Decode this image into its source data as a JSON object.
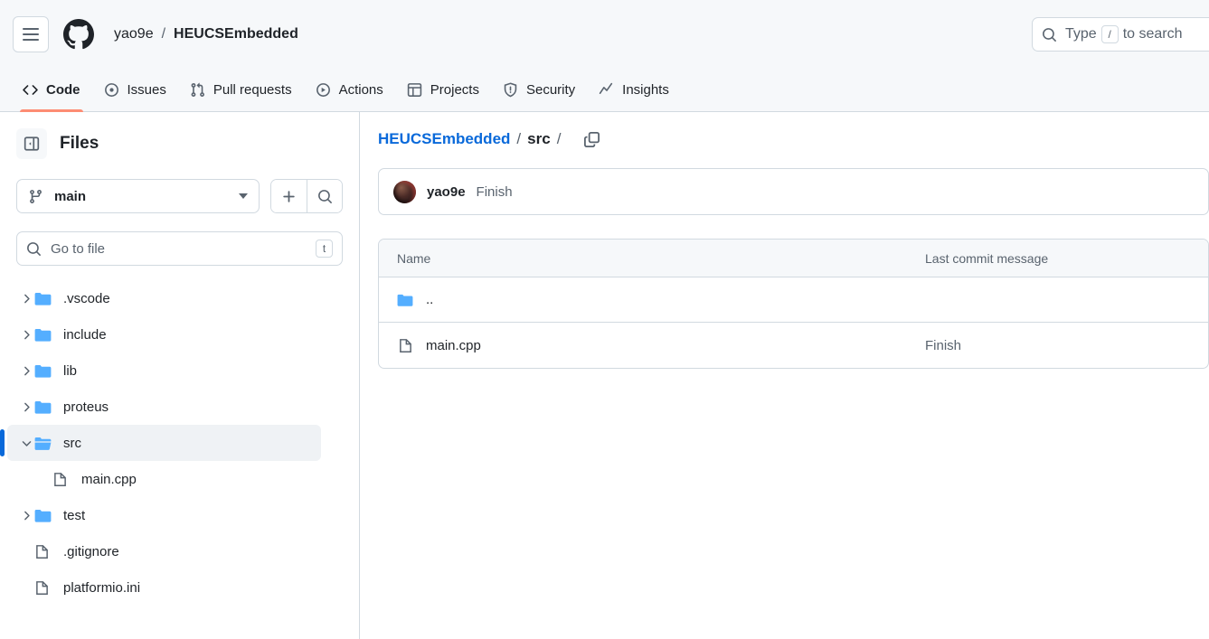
{
  "header": {
    "menu_label": "Open global navigation menu",
    "logo_name": "github-logo",
    "owner": "yao9e",
    "separator": "/",
    "repo": "HEUCSEmbedded",
    "search": {
      "placeholder_before": "Type",
      "key_hint": "/",
      "placeholder_after": "to search"
    }
  },
  "nav": {
    "tabs": [
      {
        "label": "Code",
        "icon": "code-icon",
        "active": true
      },
      {
        "label": "Issues",
        "icon": "issue-opened-icon",
        "active": false
      },
      {
        "label": "Pull requests",
        "icon": "git-pull-request-icon",
        "active": false
      },
      {
        "label": "Actions",
        "icon": "play-icon",
        "active": false
      },
      {
        "label": "Projects",
        "icon": "table-icon",
        "active": false
      },
      {
        "label": "Security",
        "icon": "shield-icon",
        "active": false
      },
      {
        "label": "Insights",
        "icon": "graph-icon",
        "active": false
      }
    ]
  },
  "sidebar": {
    "panel_icon": "sidebar-collapse-icon",
    "title": "Files",
    "branch": {
      "icon": "git-branch-icon",
      "name": "main",
      "chevron": "chevron-down-icon"
    },
    "add_button": "add-file-icon",
    "search_button": "search-icon",
    "file_search": {
      "icon": "search-icon",
      "placeholder": "Go to file",
      "shortcut": "t"
    },
    "tree": [
      {
        "label": ".vscode",
        "type": "folder",
        "expanded": false,
        "selected": false,
        "indent": false
      },
      {
        "label": "include",
        "type": "folder",
        "expanded": false,
        "selected": false,
        "indent": false
      },
      {
        "label": "lib",
        "type": "folder",
        "expanded": false,
        "selected": false,
        "indent": false
      },
      {
        "label": "proteus",
        "type": "folder",
        "expanded": false,
        "selected": false,
        "indent": false
      },
      {
        "label": "src",
        "type": "folder-open",
        "expanded": true,
        "selected": true,
        "indent": false
      },
      {
        "label": "main.cpp",
        "type": "file",
        "expanded": false,
        "selected": false,
        "indent": true
      },
      {
        "label": "test",
        "type": "folder",
        "expanded": false,
        "selected": false,
        "indent": false
      },
      {
        "label": ".gitignore",
        "type": "file",
        "expanded": false,
        "selected": false,
        "indent": false
      },
      {
        "label": "platformio.ini",
        "type": "file",
        "expanded": false,
        "selected": false,
        "indent": false
      }
    ]
  },
  "main": {
    "breadcrumb": {
      "repo": "HEUCSEmbedded",
      "sep1": "/",
      "current": "src",
      "sep2": "/",
      "copy_icon": "copy-path-icon"
    },
    "commit": {
      "avatar": "user-avatar",
      "author": "yao9e",
      "message": "Finish"
    },
    "table": {
      "columns": {
        "name": "Name",
        "message": "Last commit message"
      },
      "rows": [
        {
          "name": "..",
          "type": "folder",
          "message": ""
        },
        {
          "name": "main.cpp",
          "type": "file",
          "message": "Finish"
        }
      ]
    }
  },
  "colors": {
    "accent": "#0969da",
    "active_tab_underline": "#fd8c73",
    "folder_blue": "#54aeff",
    "header_bg": "#f6f8fa",
    "border": "#d1d9e0",
    "muted_text": "#59636e"
  }
}
